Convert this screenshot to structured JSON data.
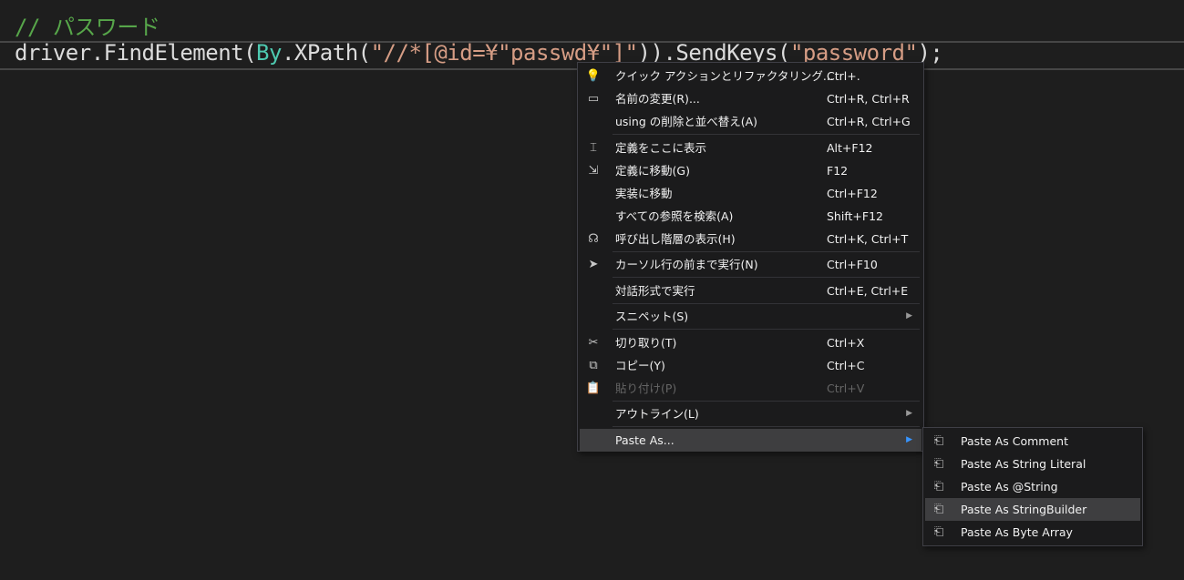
{
  "editor": {
    "comment": "// パスワード",
    "code": {
      "p1": "driver.FindElement(",
      "cls": "By",
      "p2": ".XPath(",
      "s1": "\"//*[@id=¥\"passwd¥\"]\"",
      "p3": ")).SendKeys(",
      "s2": "\"password\"",
      "p4": ");"
    }
  },
  "context_menu": [
    {
      "icon": "lightbulb-icon",
      "glyph": "💡",
      "label": "クイック アクションとリファクタリング...",
      "shortcut": "Ctrl+."
    },
    {
      "icon": "rename-icon",
      "glyph": "▭",
      "label": "名前の変更(R)...",
      "shortcut": "Ctrl+R, Ctrl+R"
    },
    {
      "icon": "",
      "glyph": "",
      "label": "using の削除と並べ替え(A)",
      "shortcut": "Ctrl+R, Ctrl+G",
      "sep_after": true
    },
    {
      "icon": "peek-definition-icon",
      "glyph": "⌶",
      "label": "定義をここに表示",
      "shortcut": "Alt+F12"
    },
    {
      "icon": "go-to-definition-icon",
      "glyph": "⇲",
      "label": "定義に移動(G)",
      "shortcut": "F12"
    },
    {
      "icon": "",
      "glyph": "",
      "label": "実装に移動",
      "shortcut": "Ctrl+F12"
    },
    {
      "icon": "",
      "glyph": "",
      "label": "すべての参照を検索(A)",
      "shortcut": "Shift+F12"
    },
    {
      "icon": "call-hierarchy-icon",
      "glyph": "☊",
      "label": "呼び出し階層の表示(H)",
      "shortcut": "Ctrl+K, Ctrl+T",
      "sep_after": true
    },
    {
      "icon": "cursor-icon",
      "glyph": "➤",
      "label": "カーソル行の前まで実行(N)",
      "shortcut": "Ctrl+F10",
      "sep_after": true
    },
    {
      "icon": "",
      "glyph": "",
      "label": "対話形式で実行",
      "shortcut": "Ctrl+E, Ctrl+E",
      "sep_after": true
    },
    {
      "icon": "",
      "glyph": "",
      "label": "スニペット(S)",
      "shortcut": "",
      "submenu": true,
      "sep_after": true
    },
    {
      "icon": "scissors-icon",
      "glyph": "✂",
      "label": "切り取り(T)",
      "shortcut": "Ctrl+X"
    },
    {
      "icon": "copy-icon",
      "glyph": "⧉",
      "label": "コピー(Y)",
      "shortcut": "Ctrl+C"
    },
    {
      "icon": "paste-icon",
      "glyph": "📋",
      "label": "貼り付け(P)",
      "shortcut": "Ctrl+V",
      "disabled": true,
      "sep_after": true
    },
    {
      "icon": "",
      "glyph": "",
      "label": "アウトライン(L)",
      "shortcut": "",
      "submenu": true,
      "sep_after": true
    },
    {
      "icon": "",
      "glyph": "",
      "label": "Paste As...",
      "shortcut": "",
      "submenu": true,
      "highlighted": true
    }
  ],
  "paste_as_submenu": [
    {
      "label": "Paste As Comment"
    },
    {
      "label": "Paste As String Literal"
    },
    {
      "label": "Paste As @String"
    },
    {
      "label": "Paste As StringBuilder",
      "highlighted": true
    },
    {
      "label": "Paste As Byte Array"
    }
  ]
}
